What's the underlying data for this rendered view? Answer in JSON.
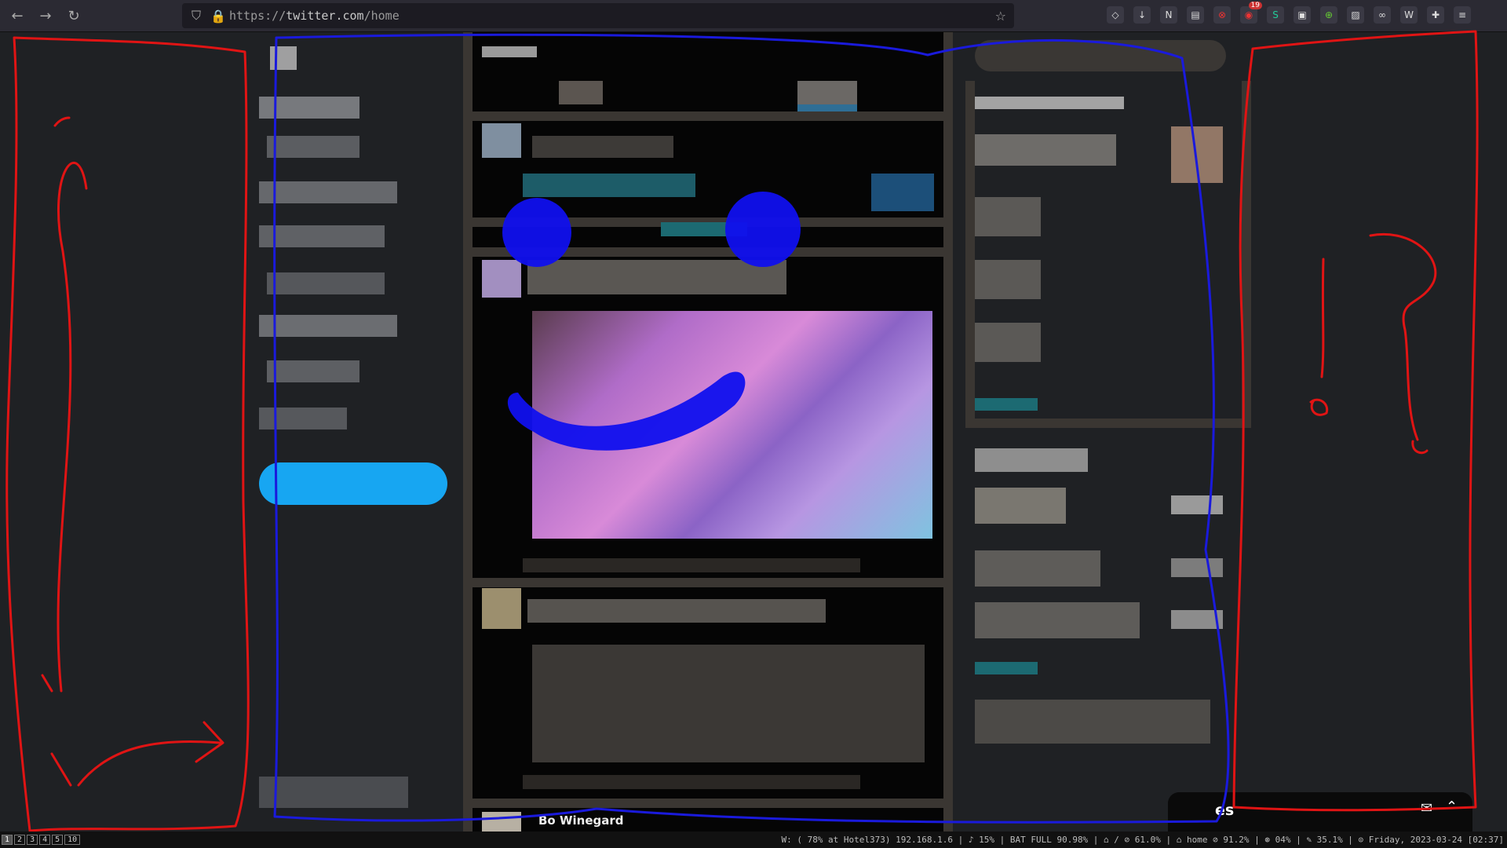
{
  "browser": {
    "url_prefix": "https://",
    "url_domain": "twitter.com",
    "url_path": "/home",
    "extension_badge": "19"
  },
  "status_bar": {
    "workspaces": [
      "1",
      "2",
      "3",
      "4",
      "5",
      "10"
    ],
    "active_workspace": "1",
    "text": "W: ( 78% at Hotel373) 192.168.1.6 | ♪ 15% | BAT FULL 90.98% | ⌂ / ⊘ 61.0% | ⌂ home ⊘ 91.2% | ⊛ 04% | ✎ 35.1% | ⊙ Friday, 2023-03-24 [02:37]"
  },
  "timeline": {
    "bottom_name": "Bo Winegard"
  },
  "messages": {
    "label": "es"
  }
}
